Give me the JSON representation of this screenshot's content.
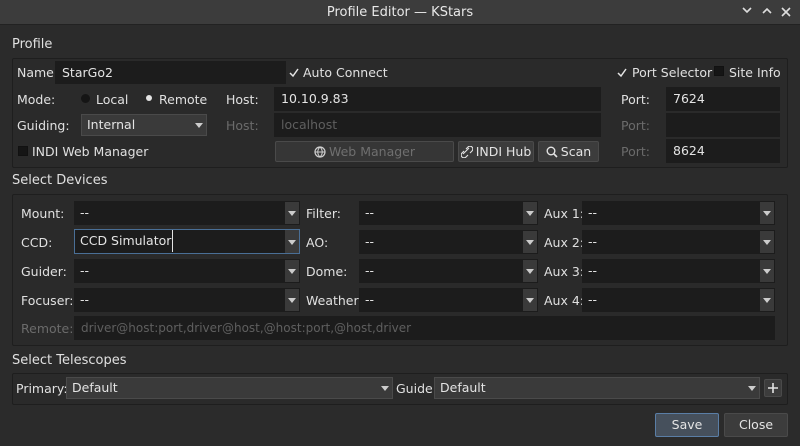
{
  "window": {
    "title": "Profile Editor — KStars",
    "controls": [
      "chevron-down-icon",
      "chevron-up-icon",
      "close-icon"
    ]
  },
  "profile": {
    "section_title": "Profile",
    "name_label": "Name:",
    "name_value": "StarGo2",
    "auto_connect_label": "Auto Connect",
    "auto_connect_checked": true,
    "port_selector_label": "Port Selector",
    "port_selector_checked": true,
    "site_info_label": "Site Info",
    "site_info_checked": false,
    "mode_label": "Mode:",
    "mode_local": "Local",
    "mode_remote": "Remote",
    "mode_selected": "Remote",
    "host_label": "Host:",
    "host_value": "10.10.9.83",
    "port_label": "Port:",
    "port_value": "7624",
    "guiding_label": "Guiding:",
    "guiding_value": "Internal",
    "guide_host_label": "Host:",
    "guide_host_placeholder": "localhost",
    "guide_port_label": "Port:",
    "guide_port_value": "",
    "indi_web_manager_label": "INDI Web Manager",
    "indi_web_manager_checked": false,
    "web_manager_button": "Web Manager",
    "indi_hub_button": "INDI Hub",
    "scan_button": "Scan",
    "web_port_label": "Port:",
    "web_port_value": "8624"
  },
  "devices": {
    "section_title": "Select Devices",
    "mount_label": "Mount:",
    "mount_value": "--",
    "ccd_label": "CCD:",
    "ccd_value": "CCD Simulator",
    "guider_label": "Guider:",
    "guider_value": "--",
    "focuser_label": "Focuser:",
    "focuser_value": "--",
    "filter_label": "Filter:",
    "filter_value": "--",
    "ao_label": "AO:",
    "ao_value": "--",
    "dome_label": "Dome:",
    "dome_value": "--",
    "weather_label": "Weather:",
    "weather_value": "--",
    "aux1_label": "Aux 1:",
    "aux1_value": "--",
    "aux2_label": "Aux 2:",
    "aux2_value": "--",
    "aux3_label": "Aux 3:",
    "aux3_value": "--",
    "aux4_label": "Aux 4:",
    "aux4_value": "--",
    "remote_label": "Remote:",
    "remote_placeholder": "driver@host:port,driver@host,@host:port,@host,driver"
  },
  "telescopes": {
    "section_title": "Select Telescopes",
    "primary_label": "Primary:",
    "primary_value": "Default",
    "guide_label": "Guide:",
    "guide_value": "Default"
  },
  "footer": {
    "save_label": "Save",
    "close_label": "Close"
  },
  "colors": {
    "window_bg": "#2b2b2b",
    "field_bg": "#1c1c1c",
    "focus_border": "#4a6f96"
  }
}
